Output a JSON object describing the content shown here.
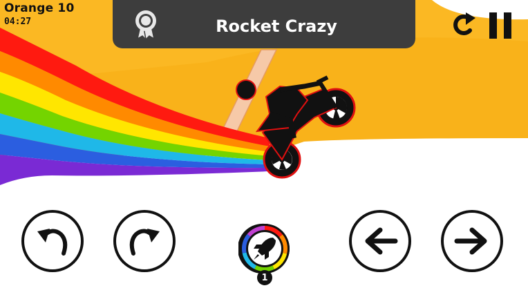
{
  "hud": {
    "level_name": "Orange 10",
    "timer": "04:27"
  },
  "banner": {
    "title": "Rocket Crazy",
    "icon": "medal-ribbon-icon"
  },
  "top_controls": {
    "restart_icon": "restart-icon",
    "pause_icon": "pause-icon"
  },
  "controls": {
    "lean_back_icon": "rotate-counterclockwise-icon",
    "lean_forward_icon": "rotate-clockwise-icon",
    "brake_icon": "arrow-left-icon",
    "accelerate_icon": "arrow-right-icon",
    "boost_icon": "rocket-icon",
    "boost_count": "1"
  },
  "colors": {
    "background_orange": "#f9b21a",
    "banner": "#3d3d3d",
    "rainbow": [
      "#ff1a10",
      "#ff8a00",
      "#ffe600",
      "#74d400",
      "#1fb8e8",
      "#2b5ee0",
      "#7a2ad4"
    ]
  }
}
